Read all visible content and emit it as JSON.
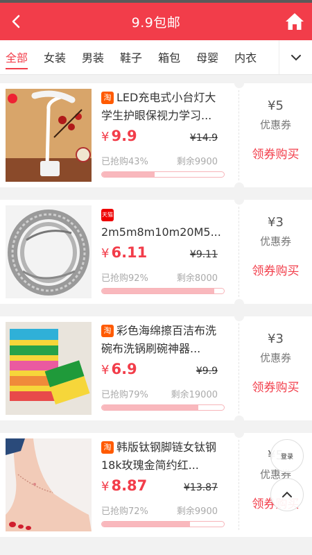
{
  "header": {
    "title": "9.9包邮"
  },
  "categories": [
    "全部",
    "女装",
    "男装",
    "鞋子",
    "箱包",
    "母婴",
    "内衣"
  ],
  "products": [
    {
      "shop": "taobao",
      "shop_badge": "淘",
      "name": "LED充电式小台灯大学生护眼保视力学习...",
      "price": "9.9",
      "orig_price": "14.9",
      "sold": "已抢购43%",
      "sold_pct": 43,
      "left": "剩余9900",
      "coupon_amount": "¥5",
      "coupon_label": "优惠券",
      "buy_label": "领券购买"
    },
    {
      "shop": "tmall",
      "shop_badge": "天猫",
      "name": "2m5m8m10m20M5...",
      "price": "6.11",
      "orig_price": "9.11",
      "sold": "已抢购92%",
      "sold_pct": 92,
      "left": "剩余8000",
      "coupon_amount": "¥3",
      "coupon_label": "优惠券",
      "buy_label": "领券购买"
    },
    {
      "shop": "taobao",
      "shop_badge": "淘",
      "name": "彩色海绵擦百洁布洗碗布洗锅刷碗神器...",
      "price": "6.9",
      "orig_price": "9.9",
      "sold": "已抢购79%",
      "sold_pct": 79,
      "left": "剩余19000",
      "coupon_amount": "¥3",
      "coupon_label": "优惠券",
      "buy_label": "领券购买"
    },
    {
      "shop": "taobao",
      "shop_badge": "淘",
      "name": "韩版钛钢脚链女钛钢18k玫瑰金简约红...",
      "price": "8.87",
      "orig_price": "13.87",
      "sold": "已抢购72%",
      "sold_pct": 72,
      "left": "剩余9900",
      "coupon_amount": "¥5",
      "coupon_label": "优惠券",
      "buy_label": "领券购买"
    }
  ],
  "price_symbol": "¥",
  "floating": {
    "login_label": "登录"
  },
  "colors": {
    "brand": "#f23d4a",
    "progress": "#f9b8bd"
  }
}
